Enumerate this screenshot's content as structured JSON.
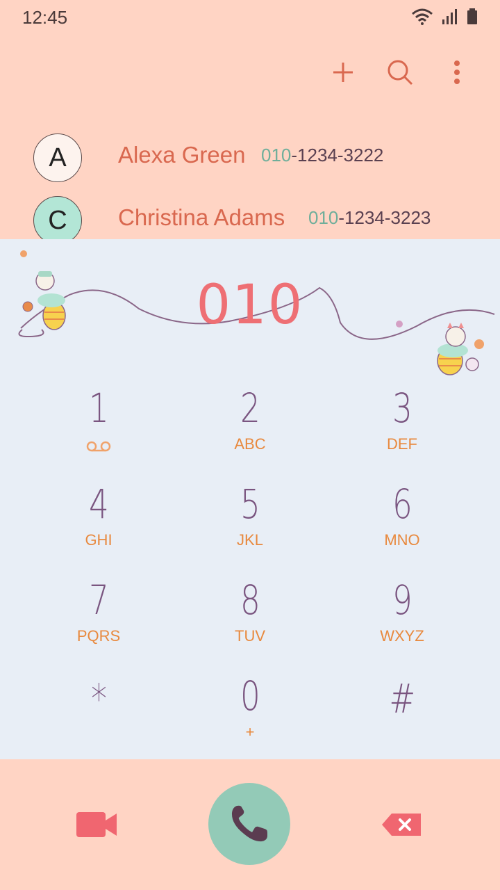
{
  "status_bar": {
    "time": "12:45"
  },
  "toolbar": {
    "add_icon": "plus-icon",
    "search_icon": "search-icon",
    "more_icon": "more-vertical-icon"
  },
  "contacts": [
    {
      "initial": "A",
      "name": "Alexa Green",
      "number_match": "010",
      "number_rest": "-1234-3222",
      "avatar_color": "#fdf3ee"
    },
    {
      "initial": "C",
      "name": "Christina Adams",
      "number_match": "010",
      "number_rest": "-1234-3223",
      "avatar_color": "#b3e6d6"
    }
  ],
  "dialer": {
    "entered_number": "010",
    "keys": [
      {
        "digit": "1",
        "letters": ""
      },
      {
        "digit": "2",
        "letters": "ABC"
      },
      {
        "digit": "3",
        "letters": "DEF"
      },
      {
        "digit": "4",
        "letters": "GHI"
      },
      {
        "digit": "5",
        "letters": "JKL"
      },
      {
        "digit": "6",
        "letters": "MNO"
      },
      {
        "digit": "7",
        "letters": "PQRS"
      },
      {
        "digit": "8",
        "letters": "TUV"
      },
      {
        "digit": "9",
        "letters": "WXYZ"
      },
      {
        "digit": "*",
        "letters": ""
      },
      {
        "digit": "0",
        "letters": "+"
      },
      {
        "digit": "#",
        "letters": ""
      }
    ]
  },
  "actions": {
    "video_call_icon": "video-call-icon",
    "call_icon": "phone-icon",
    "backspace_icon": "backspace-icon"
  },
  "colors": {
    "accent": "#ee6f74",
    "call_button": "#93cab7",
    "digit": "#7a5580",
    "letters": "#e8893e",
    "name": "#d9684f"
  }
}
